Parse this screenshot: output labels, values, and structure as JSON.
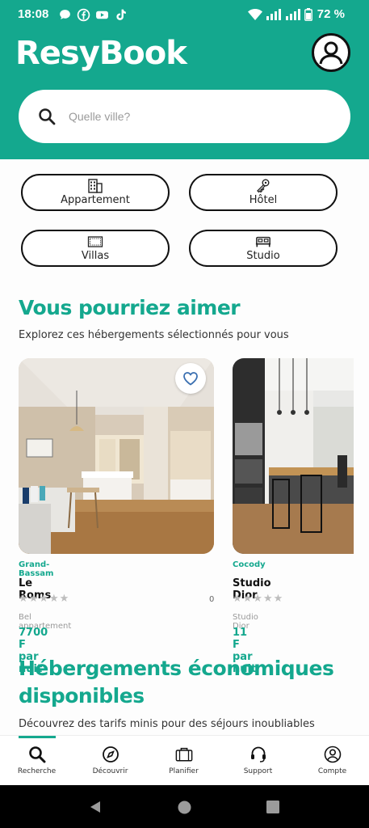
{
  "status_bar": {
    "time": "18:08",
    "battery": "72 %"
  },
  "header": {
    "brand": "ResyBook",
    "search_placeholder": "Quelle ville?"
  },
  "categories": [
    {
      "label": "Appartement",
      "icon": "building-icon"
    },
    {
      "label": "Hôtel",
      "icon": "key-icon"
    },
    {
      "label": "Villas",
      "icon": "villa-icon"
    },
    {
      "label": "Studio",
      "icon": "bed-icon"
    }
  ],
  "section1": {
    "title": "Vous pourriez aimer",
    "subtitle": "Explorez ces hébergements sélectionnés pour vous"
  },
  "cards": [
    {
      "city": "Grand-Bassam",
      "name": "Le Roms",
      "stars": "★★★★★",
      "reviews": "0",
      "type": "Bel appartement",
      "price": "7700 F par nuit"
    },
    {
      "city": "Cocody",
      "name": "Studio Dior",
      "stars": "★★★★★",
      "type": "Studio Dior",
      "price": "11 F par nuit"
    }
  ],
  "section2": {
    "title_line1": "Hébergements économiques",
    "title_line2": "disponibles",
    "subtitle": "Découvrez des tarifs minis pour des séjours inoubliables"
  },
  "nav": [
    {
      "label": "Recherche",
      "icon": "search-icon",
      "active": true
    },
    {
      "label": "Découvrir",
      "icon": "compass-icon"
    },
    {
      "label": "Planifier",
      "icon": "briefcase-icon"
    },
    {
      "label": "Support",
      "icon": "headset-icon"
    },
    {
      "label": "Compte",
      "icon": "account-icon"
    }
  ],
  "colors": {
    "brand": "#14a88e",
    "text": "#111111",
    "star_inactive": "#bdbdbd"
  }
}
